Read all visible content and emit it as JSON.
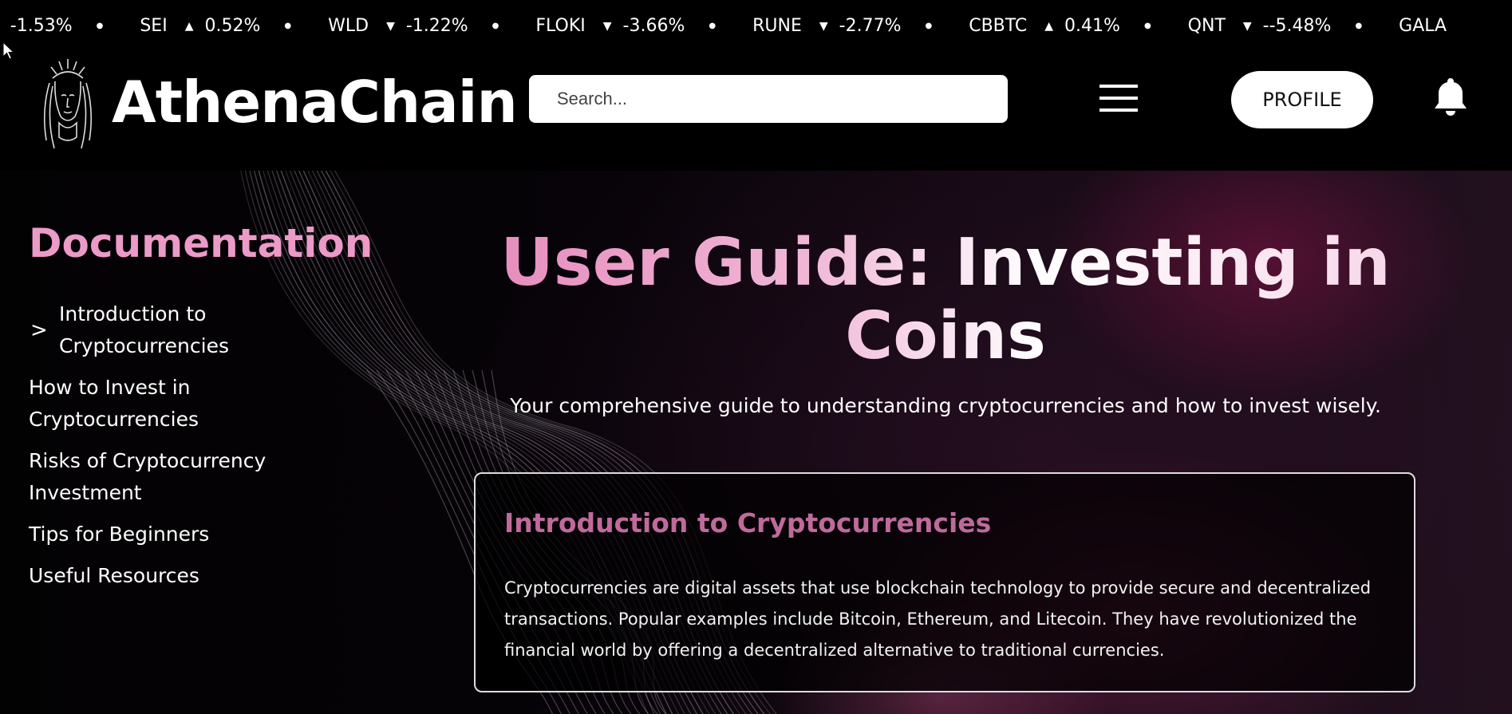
{
  "ticker": [
    {
      "symbol": "",
      "direction": "down",
      "change": "-1.53%"
    },
    {
      "symbol": "SEI",
      "direction": "up",
      "change": "0.52%"
    },
    {
      "symbol": "WLD",
      "direction": "down",
      "change": "-1.22%"
    },
    {
      "symbol": "FLOKI",
      "direction": "down",
      "change": "-3.66%"
    },
    {
      "symbol": "RUNE",
      "direction": "down",
      "change": "-2.77%"
    },
    {
      "symbol": "CBBTC",
      "direction": "up",
      "change": "0.41%"
    },
    {
      "symbol": "QNT",
      "direction": "down",
      "change": "--5.48%"
    },
    {
      "symbol": "GALA",
      "direction": "",
      "change": ""
    }
  ],
  "header": {
    "brand": "AthenaChain",
    "search_placeholder": "Search...",
    "profile_label": "PROFILE",
    "icons": [
      "athena-logo-icon",
      "hamburger-menu-icon",
      "bell-icon"
    ]
  },
  "sidebar": {
    "title": "Documentation",
    "active_marker": ">",
    "items": [
      {
        "label": "Introduction to Cryptocurrencies",
        "active": true
      },
      {
        "label": "How to Invest in Cryptocurrencies",
        "active": false
      },
      {
        "label": "Risks of Cryptocurrency Investment",
        "active": false
      },
      {
        "label": "Tips for Beginners",
        "active": false
      },
      {
        "label": "Useful Resources",
        "active": false
      }
    ]
  },
  "main": {
    "title": "User Guide: Investing in Coins",
    "subtitle": "Your comprehensive guide to understanding cryptocurrencies and how to invest wisely.",
    "section": {
      "title": "Introduction to Cryptocurrencies",
      "body": "Cryptocurrencies are digital assets that use blockchain technology to provide secure and decentralized transactions. Popular examples include Bitcoin, Ethereum, and Litecoin. They have revolutionized the financial world by offering a decentralized alternative to traditional currencies."
    }
  },
  "colors": {
    "accent_pink": "#ec9ac8",
    "section_title": "#c06a9c",
    "background": "#000000"
  }
}
